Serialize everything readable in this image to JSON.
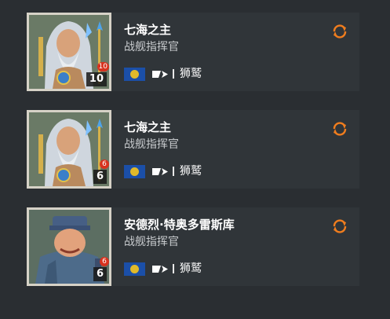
{
  "commanders": [
    {
      "name": "七海之主",
      "role": "战舰指挥官",
      "level": "10",
      "skill_points": "10",
      "ship": "狮鹫",
      "portrait": "poseidon-portrait",
      "nation": "europe-flag"
    },
    {
      "name": "七海之主",
      "role": "战舰指挥官",
      "level": "6",
      "skill_points": "6",
      "ship": "狮鹫",
      "portrait": "poseidon-portrait",
      "nation": "europe-flag"
    },
    {
      "name": "安德烈·特奥多雷斯库",
      "role": "战舰指挥官",
      "level": "6",
      "skill_points": "6",
      "ship": "狮鹫",
      "portrait": "sailor-portrait",
      "nation": "europe-flag"
    }
  ],
  "colors": {
    "accent": "#f07d1e",
    "badge": "#d8321e",
    "flag": "#1b4fa8"
  },
  "icons": {
    "swap": "swap-icon",
    "ship_type": "battleship-icon"
  }
}
